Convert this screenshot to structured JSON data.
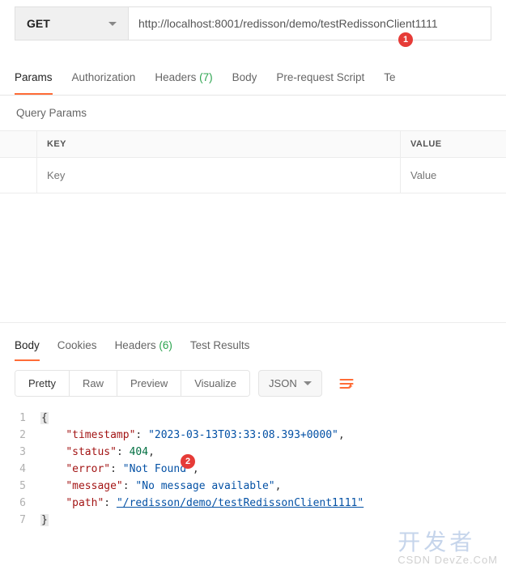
{
  "request": {
    "method": "GET",
    "url": "http://localhost:8001/redisson/demo/testRedissonClient1111"
  },
  "badges": {
    "one": "1",
    "two": "2"
  },
  "tabs": {
    "params": "Params",
    "authorization": "Authorization",
    "headers": "Headers",
    "headers_count": "(7)",
    "body": "Body",
    "prerequest": "Pre-request Script",
    "tests_short": "Te"
  },
  "query": {
    "title": "Query Params",
    "head_key": "KEY",
    "head_value": "VALUE",
    "placeholder_key": "Key",
    "placeholder_value": "Value"
  },
  "response_tabs": {
    "body": "Body",
    "cookies": "Cookies",
    "headers": "Headers",
    "headers_count": "(6)",
    "tests": "Test Results"
  },
  "body_toolbar": {
    "pretty": "Pretty",
    "raw": "Raw",
    "preview": "Preview",
    "visualize": "Visualize",
    "format": "JSON"
  },
  "code_lines": [
    "1",
    "2",
    "3",
    "4",
    "5",
    "6",
    "7"
  ],
  "json_resp": {
    "timestamp_key": "\"timestamp\"",
    "timestamp_val": "\"2023-03-13T03:33:08.393+0000\"",
    "status_key": "\"status\"",
    "status_val": "404",
    "error_key": "\"error\"",
    "error_val": "\"Not Found\"",
    "message_key": "\"message\"",
    "message_val": "\"No message available\"",
    "path_key": "\"path\"",
    "path_val": "\"/redisson/demo/testRedissonClient1111\""
  },
  "watermark": {
    "main": "开发者",
    "sub": "CSDN DevZe.CoM"
  }
}
